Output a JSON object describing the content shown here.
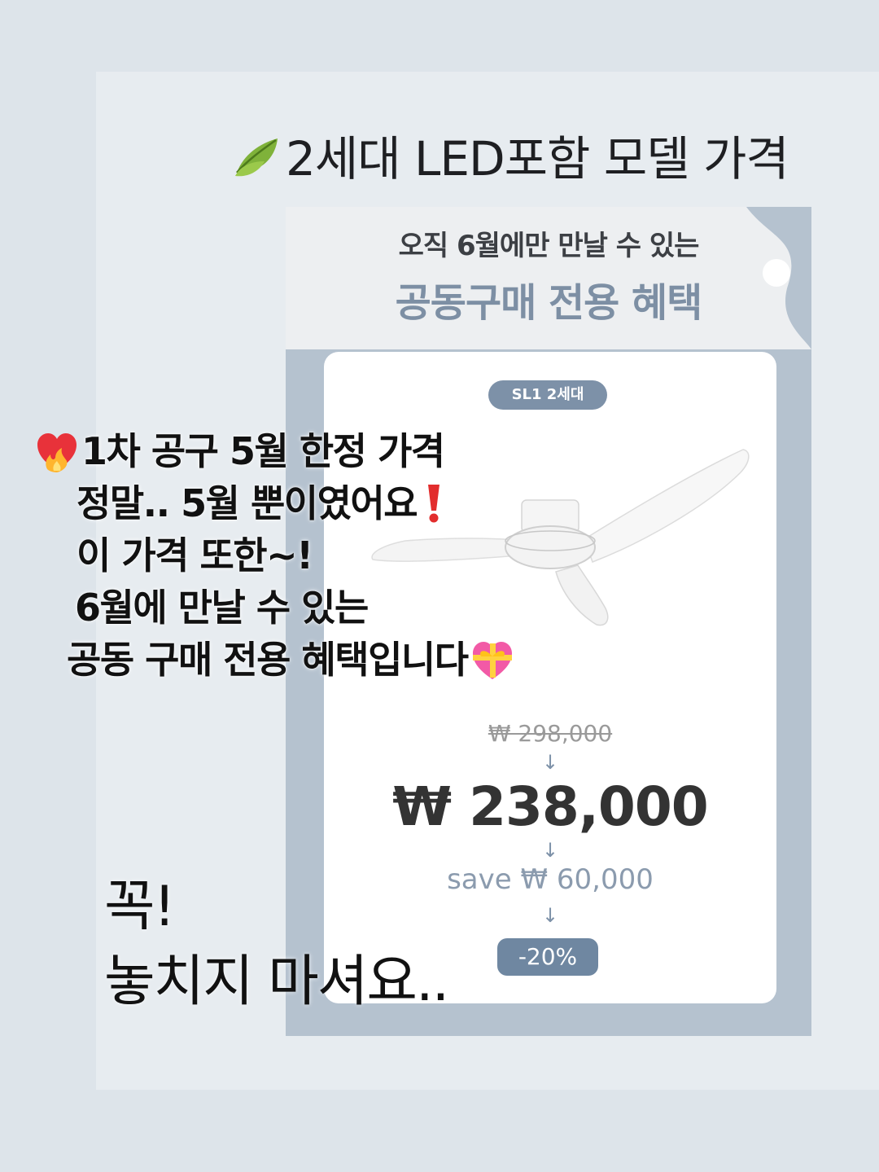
{
  "header": {
    "leaf_icon": "leaf-icon",
    "title": "2세대 LED포함 모델 가격"
  },
  "promo": {
    "subtitle": "오직 6월에만 만날 수 있는",
    "title": "공동구매 전용 혜택",
    "badge": "SL1 2세대",
    "product_icon": "ceiling-fan",
    "old_price": "₩ 298,000",
    "arrow": "↓",
    "new_price": "₩ 238,000",
    "save": "save ₩ 60,000",
    "discount": "-20%",
    "colors": {
      "accent": "#7d91a8",
      "background": "#b5c2cf",
      "card": "#ffffff"
    }
  },
  "overlay": {
    "line1": "1차 공구 5월 한정 가격",
    "line1_icon": "burning-heart-icon",
    "line2": "정말..  5월 뿐이였어요",
    "line2_icon": "red-exclamation-icon",
    "line3": "이 가격 또한~!",
    "line4": "6월에 만날 수 있는",
    "line5": "공동 구매 전용 혜택입니다",
    "line5_icon": "heart-with-ribbon-icon"
  },
  "closing": {
    "line1": "꼭!",
    "line2": "놓치지 마셔요.."
  }
}
